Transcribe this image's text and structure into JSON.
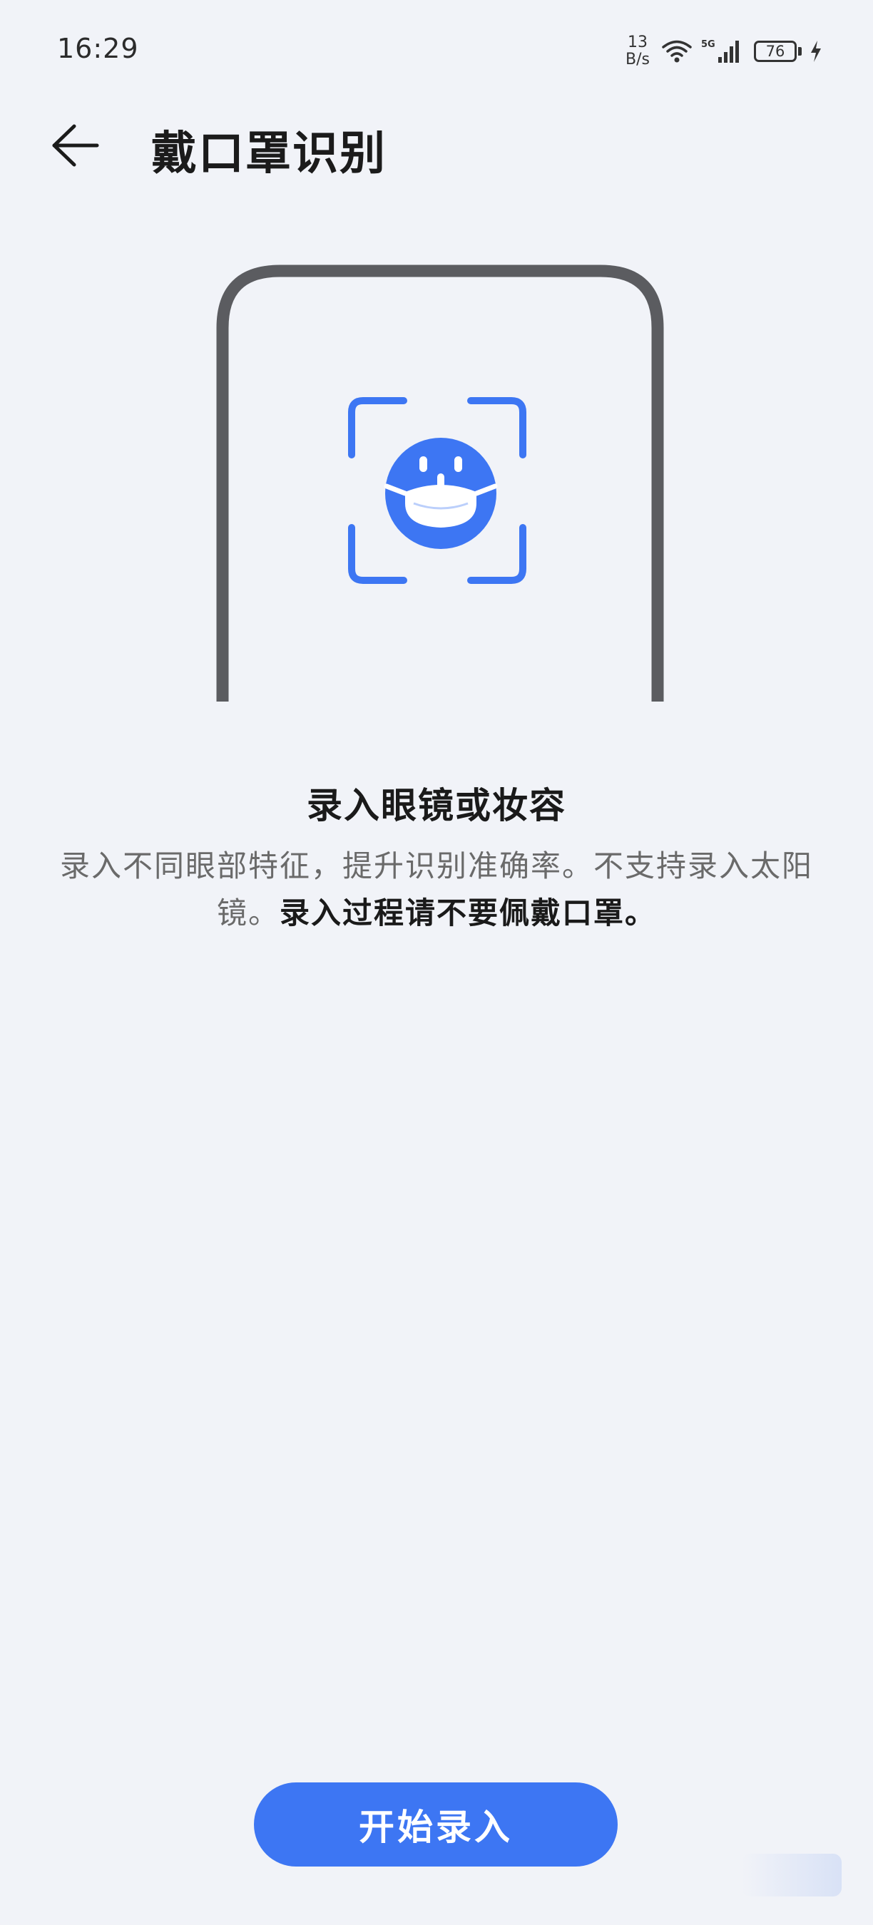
{
  "status_bar": {
    "time": "16:29",
    "net_speed_value": "13",
    "net_speed_unit": "B/s",
    "network_type": "5G",
    "battery_level": "76",
    "icons": [
      "wifi-icon",
      "signal-5g-icon",
      "battery-icon",
      "charging-icon"
    ]
  },
  "header": {
    "back_icon": "arrow-left-icon",
    "title": "戴口罩识别"
  },
  "illustration": {
    "icon": "face-with-mask-scan-icon",
    "colors": {
      "phone_frame": "#5b5c60",
      "accent": "#3d76f3"
    }
  },
  "info": {
    "heading": "录入眼镜或妆容",
    "body_normal": "录入不同眼部特征，提升识别准确率。不支持录入太阳镜。",
    "body_strong": "录入过程请不要佩戴口罩。"
  },
  "actions": {
    "start_label": "开始录入"
  },
  "colors": {
    "background": "#f1f3f8",
    "primary": "#3d76f3"
  }
}
